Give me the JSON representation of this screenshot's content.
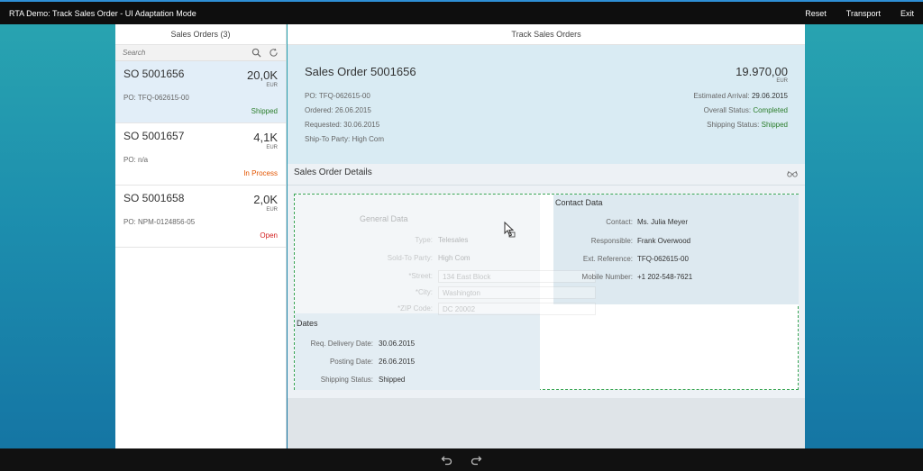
{
  "app": {
    "title": "RTA Demo: Track Sales Order  - UI Adaptation Mode",
    "actions": [
      "Reset",
      "Transport",
      "Exit"
    ]
  },
  "master": {
    "header": "Sales Orders (3)",
    "search_placeholder": "Search",
    "items": [
      {
        "title": "SO 5001656",
        "amount": "20,0K",
        "currency": "EUR",
        "po": "PO: TFQ-062615-00",
        "status": "Shipped",
        "status_color": "#2b7d2b"
      },
      {
        "title": "SO 5001657",
        "amount": "4,1K",
        "currency": "EUR",
        "po": "PO: n/a",
        "status": "In Process",
        "status_color": "#e35500"
      },
      {
        "title": "SO 5001658",
        "amount": "2,0K",
        "currency": "EUR",
        "po": "PO: NPM-0124856-05",
        "status": "Open",
        "status_color": "#d32020"
      }
    ]
  },
  "detail": {
    "header": "Track Sales Orders",
    "object": {
      "title": "Sales Order 5001656",
      "amount": "19.970,00",
      "currency": "EUR",
      "attributes": [
        "PO: TFQ-062615-00",
        "Ordered: 26.06.2015",
        "Requested: 30.06.2015",
        "Ship-To Party: High Com"
      ],
      "estimated_arrival_label": "Estimated Arrival:",
      "estimated_arrival": "29.06.2015",
      "overall_status_label": "Overall Status:",
      "overall_status": "Completed",
      "shipping_status_label": "Shipping Status:",
      "shipping_status": "Shipped"
    },
    "section_title": "Sales Order Details",
    "general": {
      "title": "General Data",
      "fields": [
        {
          "label": "Type:",
          "value": "Telesales"
        },
        {
          "label": "Sold-To Party:",
          "value": "High Com"
        },
        {
          "label": "*Street:",
          "value": "134 East Block"
        },
        {
          "label": "*City:",
          "value": "Washington"
        },
        {
          "label": "*ZIP Code:",
          "value": "DC 20002"
        }
      ]
    },
    "contact": {
      "title": "Contact Data",
      "fields": [
        {
          "label": "Contact:",
          "value": "Ms. Julia Meyer"
        },
        {
          "label": "Responsible:",
          "value": "Frank Overwood"
        },
        {
          "label": "Ext. Reference:",
          "value": "TFQ-062615-00"
        },
        {
          "label": "Mobile Number:",
          "value": "+1 202-548-7621"
        }
      ]
    },
    "dates": {
      "title": "Dates",
      "fields": [
        {
          "label": "Req. Delivery Date:",
          "value": "30.06.2015"
        },
        {
          "label": "Posting Date:",
          "value": "26.06.2015"
        },
        {
          "label": "Shipping Status:",
          "value": "Shipped"
        }
      ]
    }
  },
  "colors": {
    "accent": "#2e8fd6",
    "dropzone_border": "#3aa655",
    "selected_item": "#e2eef8"
  }
}
